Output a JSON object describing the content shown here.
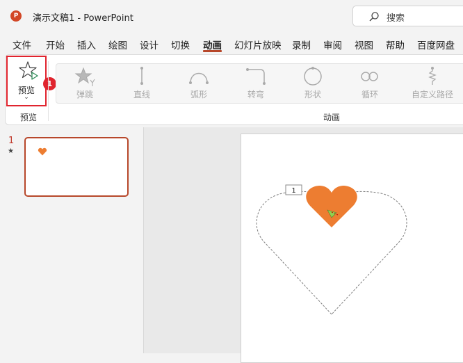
{
  "window": {
    "title": "演示文稿1  -  PowerPoint",
    "app_logo": "P"
  },
  "search": {
    "placeholder": "搜索"
  },
  "menu": [
    "文件",
    "开始",
    "插入",
    "绘图",
    "设计",
    "切换",
    "动画",
    "幻灯片放映",
    "录制",
    "审阅",
    "视图",
    "帮助",
    "百度网盘"
  ],
  "menu_active": "动画",
  "ribbon": {
    "preview": {
      "label": "预览",
      "group_label": "预览"
    },
    "badge": "1",
    "animation_group_label": "动画",
    "gallery": [
      "弹跳",
      "直线",
      "弧形",
      "转弯",
      "形状",
      "循环",
      "自定义路径"
    ]
  },
  "slides": {
    "number": "1",
    "animation_marker": "★"
  },
  "canvas": {
    "anim_tag": "1"
  },
  "colors": {
    "accent": "#b7472a",
    "highlight": "#e0242e",
    "heart": "#ed7d31",
    "arrow": "#92d050"
  }
}
